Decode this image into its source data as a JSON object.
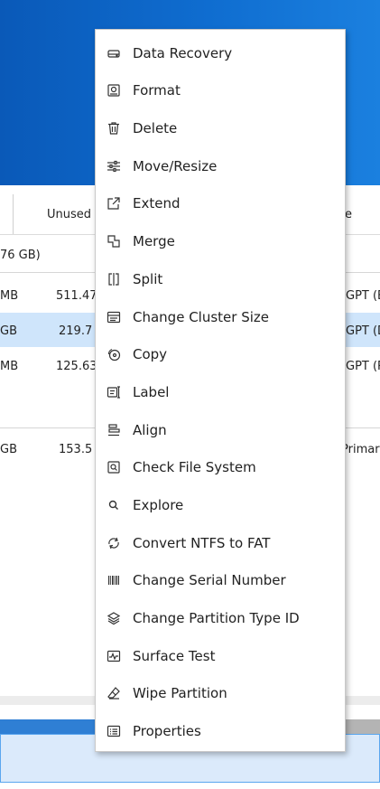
{
  "table": {
    "header_unused": "Unused",
    "header_type_partial": "e",
    "disk_label_partial": "76 GB)",
    "rows": [
      {
        "capacity": "MB",
        "unused": "511.47",
        "type": "GPT (E"
      },
      {
        "capacity": "GB",
        "unused": "219.7",
        "type": "GPT (D"
      },
      {
        "capacity": "MB",
        "unused": "125.63",
        "type": "GPT (R"
      },
      {
        "capacity": "GB",
        "unused": "153.5",
        "type": "Primar"
      }
    ]
  },
  "context_menu": {
    "items": [
      {
        "label": "Data Recovery",
        "icon": "data-recovery-icon"
      },
      {
        "label": "Format",
        "icon": "format-icon"
      },
      {
        "label": "Delete",
        "icon": "trash-icon"
      },
      {
        "label": "Move/Resize",
        "icon": "sliders-icon"
      },
      {
        "label": "Extend",
        "icon": "extend-icon"
      },
      {
        "label": "Merge",
        "icon": "merge-icon"
      },
      {
        "label": "Split",
        "icon": "split-icon"
      },
      {
        "label": "Change Cluster Size",
        "icon": "cluster-size-icon"
      },
      {
        "label": "Copy",
        "icon": "copy-icon"
      },
      {
        "label": "Label",
        "icon": "label-icon"
      },
      {
        "label": "Align",
        "icon": "align-icon"
      },
      {
        "label": "Check File System",
        "icon": "check-file-system-icon"
      },
      {
        "label": "Explore",
        "icon": "magnifier-icon"
      },
      {
        "label": "Convert NTFS to FAT",
        "icon": "convert-icon"
      },
      {
        "label": "Change Serial Number",
        "icon": "barcode-icon"
      },
      {
        "label": "Change Partition Type ID",
        "icon": "layers-icon"
      },
      {
        "label": "Surface Test",
        "icon": "surface-test-icon"
      },
      {
        "label": "Wipe Partition",
        "icon": "eraser-icon"
      },
      {
        "label": "Properties",
        "icon": "properties-icon"
      }
    ]
  },
  "colors": {
    "header_blue": "#0f6dd0",
    "selection": "#cfe5fb",
    "accent": "#2f7fd4"
  }
}
